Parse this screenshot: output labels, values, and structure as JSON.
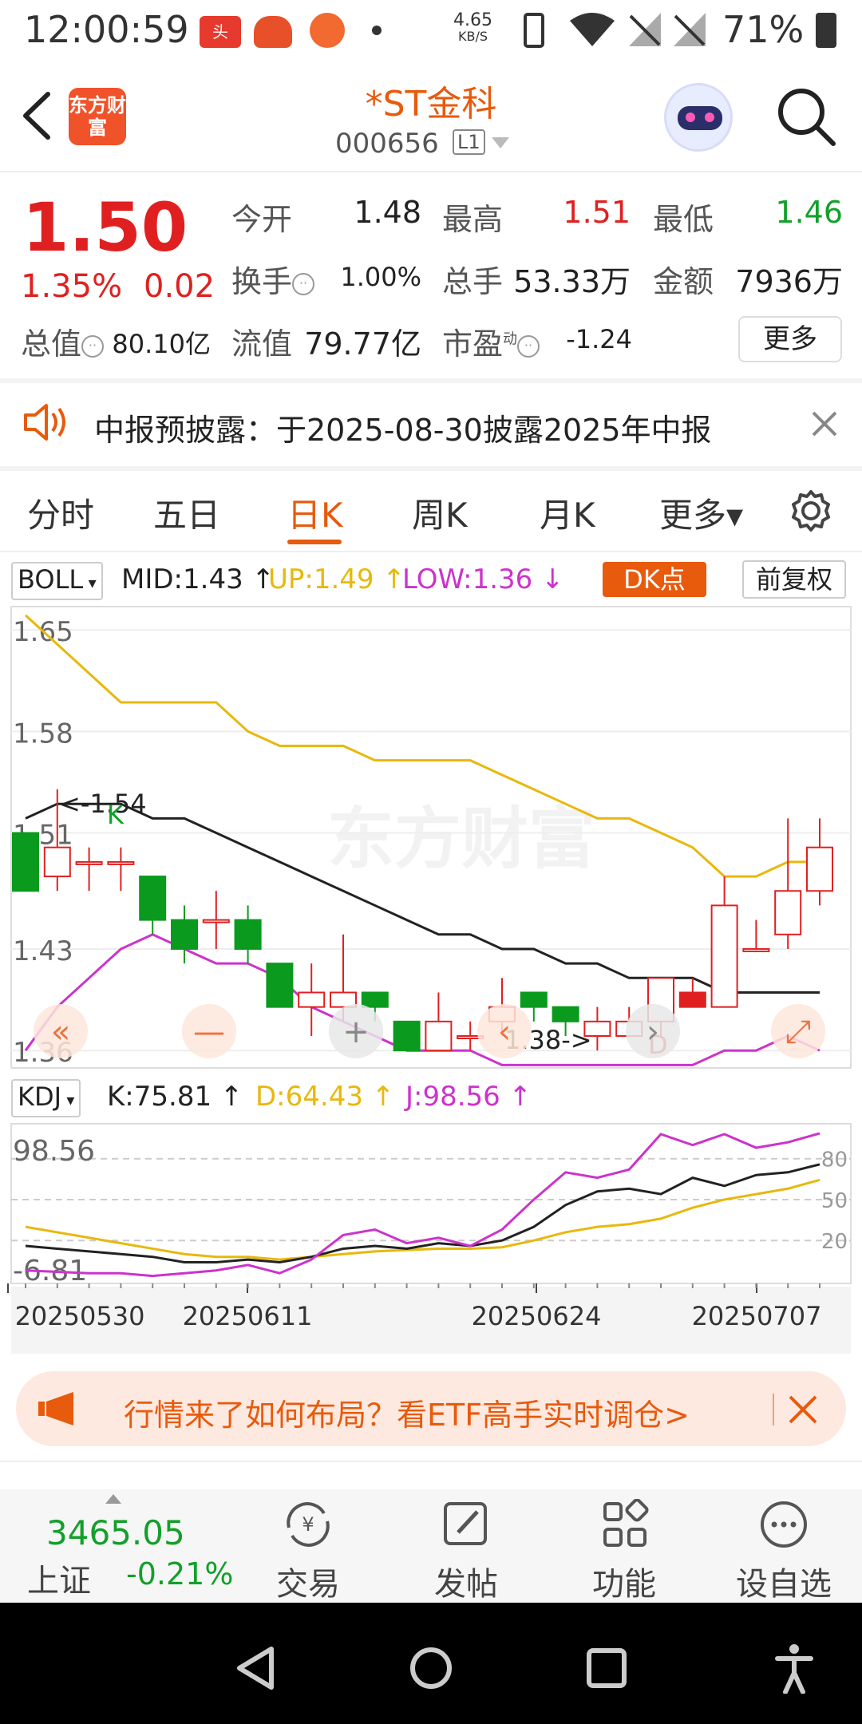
{
  "status_bar": {
    "time": "12:00:59",
    "net_speed_value": "4.65",
    "net_speed_unit": "KB/S",
    "battery": "71%"
  },
  "header": {
    "title": "*ST金科",
    "code": "000656",
    "level": "L1",
    "logo_text": "东方财富"
  },
  "quote": {
    "price": "1.50",
    "change_pct": "1.35%",
    "change": "0.02",
    "open_label": "今开",
    "open": "1.48",
    "high_label": "最高",
    "high": "1.51",
    "low_label": "最低",
    "low": "1.46",
    "turnover_label": "换手",
    "turnover": "1.00%",
    "volume_label": "总手",
    "volume": "53.33万",
    "amount_label": "金额",
    "amount": "7936万",
    "mcap_label": "总值",
    "mcap": "80.10亿",
    "float_label": "流值",
    "float_value": "79.77亿",
    "pe_label": "市盈",
    "pe_sup": "动",
    "pe": "-1.24",
    "more_label": "更多"
  },
  "notice": {
    "text": "中报预披露：于2025-08-30披露2025年中报"
  },
  "tabs": [
    {
      "label": "分时"
    },
    {
      "label": "五日"
    },
    {
      "label": "日K"
    },
    {
      "label": "周K"
    },
    {
      "label": "月K"
    },
    {
      "label": "更多▾"
    }
  ],
  "boll": {
    "name": "BOLL",
    "mid": "MID:1.43",
    "up": "UP:1.49",
    "low": "LOW:1.36",
    "dk_label": "DK点",
    "adjust_label": "前复权"
  },
  "kdj": {
    "name": "KDJ",
    "k": "K:75.81",
    "d": "D:64.43",
    "j": "J:98.56"
  },
  "chart_labels": {
    "y_1_65": "1.65",
    "y_1_58": "1.58",
    "y_1_51": "1.51",
    "y_1_43": "1.43",
    "y_1_36": "1.36",
    "max_marker": "<-1.54",
    "min_marker": "1.38->",
    "k_mark": "K",
    "d_mark": "D",
    "kdj_top": "98.56",
    "kdj_bottom": "-6.81",
    "kdj_80": "80",
    "kdj_50": "50",
    "kdj_20": "20",
    "watermark": "东方财富"
  },
  "dates": [
    "20250530",
    "20250611",
    "20250624",
    "20250707"
  ],
  "chart_data": {
    "type": "candlestick",
    "candles": [
      {
        "o": 1.51,
        "c": 1.47,
        "h": 1.51,
        "l": 1.47
      },
      {
        "o": 1.48,
        "c": 1.5,
        "h": 1.54,
        "l": 1.47
      },
      {
        "o": 1.49,
        "c": 1.49,
        "h": 1.5,
        "l": 1.47
      },
      {
        "o": 1.49,
        "c": 1.49,
        "h": 1.5,
        "l": 1.47
      },
      {
        "o": 1.48,
        "c": 1.45,
        "h": 1.48,
        "l": 1.44
      },
      {
        "o": 1.45,
        "c": 1.43,
        "h": 1.46,
        "l": 1.42
      },
      {
        "o": 1.45,
        "c": 1.45,
        "h": 1.47,
        "l": 1.43
      },
      {
        "o": 1.45,
        "c": 1.43,
        "h": 1.46,
        "l": 1.42
      },
      {
        "o": 1.42,
        "c": 1.39,
        "h": 1.42,
        "l": 1.39
      },
      {
        "o": 1.39,
        "c": 1.4,
        "h": 1.42,
        "l": 1.37
      },
      {
        "o": 1.39,
        "c": 1.4,
        "h": 1.44,
        "l": 1.38
      },
      {
        "o": 1.4,
        "c": 1.39,
        "h": 1.4,
        "l": 1.38
      },
      {
        "o": 1.38,
        "c": 1.36,
        "h": 1.38,
        "l": 1.36
      },
      {
        "o": 1.36,
        "c": 1.38,
        "h": 1.4,
        "l": 1.36
      },
      {
        "o": 1.37,
        "c": 1.37,
        "h": 1.38,
        "l": 1.36
      },
      {
        "o": 1.38,
        "c": 1.39,
        "h": 1.41,
        "l": 1.37
      },
      {
        "o": 1.4,
        "c": 1.39,
        "h": 1.4,
        "l": 1.38
      },
      {
        "o": 1.39,
        "c": 1.38,
        "h": 1.39,
        "l": 1.37
      },
      {
        "o": 1.37,
        "c": 1.38,
        "h": 1.39,
        "l": 1.36
      },
      {
        "o": 1.37,
        "c": 1.38,
        "h": 1.39,
        "l": 1.37
      },
      {
        "o": 1.38,
        "c": 1.41,
        "h": 1.41,
        "l": 1.37
      },
      {
        "o": 1.39,
        "c": 1.4,
        "h": 1.41,
        "l": 1.39
      },
      {
        "o": 1.39,
        "c": 1.46,
        "h": 1.48,
        "l": 1.39
      },
      {
        "o": 1.43,
        "c": 1.43,
        "h": 1.45,
        "l": 1.43
      },
      {
        "o": 1.44,
        "c": 1.47,
        "h": 1.52,
        "l": 1.43
      },
      {
        "o": 1.47,
        "c": 1.5,
        "h": 1.52,
        "l": 1.46
      }
    ],
    "boll_up": [
      1.66,
      1.64,
      1.62,
      1.6,
      1.6,
      1.6,
      1.6,
      1.58,
      1.57,
      1.57,
      1.57,
      1.56,
      1.56,
      1.56,
      1.56,
      1.55,
      1.54,
      1.53,
      1.52,
      1.52,
      1.51,
      1.5,
      1.48,
      1.48,
      1.49,
      1.49
    ],
    "boll_mid": [
      1.52,
      1.53,
      1.53,
      1.53,
      1.52,
      1.52,
      1.51,
      1.5,
      1.49,
      1.48,
      1.47,
      1.46,
      1.45,
      1.44,
      1.44,
      1.43,
      1.43,
      1.42,
      1.42,
      1.41,
      1.41,
      1.41,
      1.4,
      1.4,
      1.4,
      1.4
    ],
    "boll_low": [
      1.36,
      1.39,
      1.41,
      1.43,
      1.44,
      1.43,
      1.42,
      1.42,
      1.41,
      1.39,
      1.38,
      1.37,
      1.36,
      1.36,
      1.36,
      1.35,
      1.35,
      1.35,
      1.35,
      1.35,
      1.35,
      1.35,
      1.36,
      1.36,
      1.37,
      1.36
    ],
    "k": [
      16,
      14,
      12,
      10,
      8,
      4,
      4,
      6,
      4,
      8,
      14,
      16,
      14,
      18,
      16,
      20,
      30,
      46,
      56,
      58,
      54,
      66,
      60,
      68,
      70,
      75.81
    ],
    "d": [
      30,
      26,
      22,
      18,
      14,
      10,
      8,
      8,
      6,
      8,
      10,
      12,
      13,
      14,
      14,
      15,
      20,
      26,
      30,
      32,
      36,
      44,
      50,
      54,
      58,
      64.43
    ],
    "j": [
      -2,
      -3,
      -4,
      -4,
      -6,
      -4,
      -2,
      2,
      -4,
      6,
      24,
      28,
      18,
      22,
      16,
      28,
      50,
      70,
      66,
      72,
      98,
      90,
      98,
      88,
      92,
      98.56
    ],
    "y_range": [
      1.36,
      1.65
    ],
    "kdj_range": [
      -6.81,
      98.56
    ]
  },
  "ad": {
    "text": "行情来了如何布局？看ETF高手实时调仓>"
  },
  "bottom_bar": {
    "index_value": "3465.05",
    "index_name": "上证",
    "index_change": "-0.21%",
    "items": [
      {
        "label": "交易"
      },
      {
        "label": "发帖"
      },
      {
        "label": "功能"
      },
      {
        "label": "设自选"
      }
    ]
  },
  "colors": {
    "rise": "#e02020",
    "fall": "#0a9a1e",
    "boll_up": "#e8b80c",
    "boll_mid": "#222222",
    "boll_low": "#cc33cc",
    "accent": "#e85a0c"
  }
}
